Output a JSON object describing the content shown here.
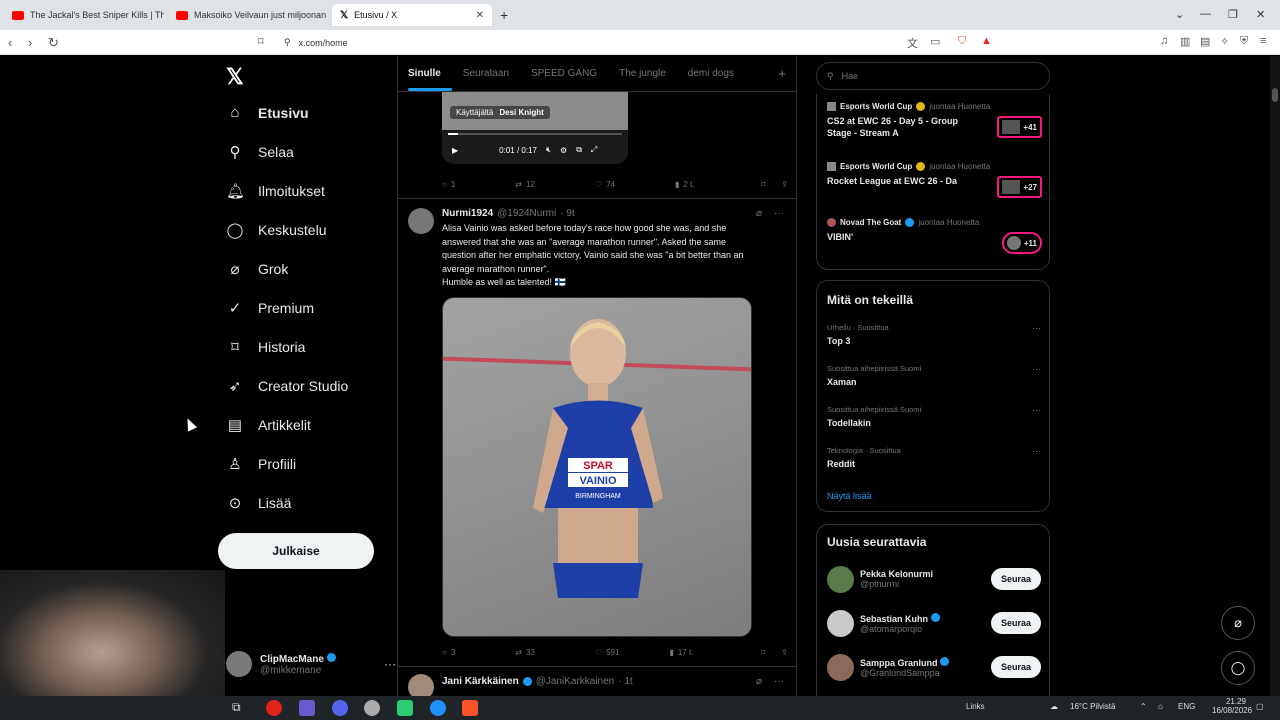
{
  "browser": {
    "tabs": [
      {
        "title": "The Jackal's Best Sniper Kills | The Day",
        "favicon_color": "#ff0000"
      },
      {
        "title": "Maksoiko Veilvaun just miljoonan vi",
        "favicon_color": "#ff0000"
      },
      {
        "title": "Etusivu / X",
        "favicon_color": "#000000"
      }
    ],
    "url": "x.com/home"
  },
  "sidebar": {
    "items": [
      {
        "label": "Etusivu",
        "icon": "home-icon"
      },
      {
        "label": "Selaa",
        "icon": "search-icon"
      },
      {
        "label": "Ilmoitukset",
        "icon": "bell-icon"
      },
      {
        "label": "Keskustelu",
        "icon": "chat-icon"
      },
      {
        "label": "Grok",
        "icon": "grok-icon"
      },
      {
        "label": "Premium",
        "icon": "premium-icon"
      },
      {
        "label": "Historia",
        "icon": "bookmark-icon"
      },
      {
        "label": "Creator Studio",
        "icon": "rocket-icon"
      },
      {
        "label": "Artikkelit",
        "icon": "article-icon"
      },
      {
        "label": "Profiili",
        "icon": "person-icon"
      },
      {
        "label": "Lisää",
        "icon": "more-circle-icon"
      }
    ],
    "post_button": "Julkaise",
    "account": {
      "name": "ClipMacMane",
      "handle": "@mikkemane"
    }
  },
  "feed": {
    "tabs": [
      "Sinulle",
      "Seurataan",
      "SPEED GANG",
      "The jungle",
      "demi dogs"
    ],
    "video": {
      "overlay_label": "Käyttäjältä",
      "overlay_user": "Desi Knight",
      "time": "0:01 / 0:17",
      "progress": 0.06
    },
    "post1_actions": {
      "replies": "1",
      "reposts": "12",
      "likes": "74",
      "views": "2 t."
    },
    "post2": {
      "name": "Nurmi1924",
      "handle": "@1924Nurmi",
      "time": "· 9t",
      "text_lines": [
        "Alisa Vainio was asked before today's race how good she was, and she",
        "answered that she was an \"average marathon runner\". Asked the same",
        "question after her emphatic victory, Vainio said she was \"a bit better than an",
        "average marathon runner\".",
        "Humble as well as talented! 🇫🇮"
      ],
      "bib_lines": [
        "SPAR",
        "VAINIO",
        "BIRMINGHAM"
      ],
      "actions": {
        "replies": "3",
        "reposts": "33",
        "likes": "591",
        "views": "17 t."
      }
    },
    "post3": {
      "name": "Jani Kärkkäinen",
      "handle": "@JaniKarkkainen",
      "time": "· 1t"
    }
  },
  "right": {
    "search_placeholder": "Hae",
    "live": [
      {
        "source": "Esports World Cup",
        "sub": "juontaa Huonetta",
        "title": "CS2 at EWC 26 - Day 5 - Group Stage - Stream A",
        "count": "+41"
      },
      {
        "source": "Esports World Cup",
        "sub": "juontaa Huonetta",
        "title": "Rocket League at EWC 26 - Da",
        "count": "+27"
      },
      {
        "source": "Novad The Goat",
        "sub": "juontaa Huonetta",
        "title": "VIBIN'",
        "count": "+11"
      }
    ],
    "trends_title": "Mitä on tekeillä",
    "trends": [
      {
        "category": "Urheilu · Suosittua",
        "name": "Top 3"
      },
      {
        "category": "Suosittua aihepiirissä Suomi",
        "name": "Xaman"
      },
      {
        "category": "Suosittua aihepiirissä Suomi",
        "name": "Todellakin"
      },
      {
        "category": "Teknologia · Suosittua",
        "name": "Reddit"
      }
    ],
    "show_more": "Näytä lisää",
    "follow_title": "Uusia seurattavia",
    "follow": [
      {
        "name": "Pekka Kelonurmi",
        "handle": "@ptnurmi",
        "button": "Seuraa"
      },
      {
        "name": "Sebastian Kuhn",
        "handle": "@atomarporqio",
        "button": "Seuraa"
      },
      {
        "name": "Samppa Granlund",
        "handle": "@GranlundSamppa",
        "button": "Seuraa"
      }
    ]
  },
  "taskbar": {
    "links": "Links",
    "weather": "16°C Pilvistä",
    "lang": "ENG",
    "time": "21.29",
    "date": "16/08/2026"
  }
}
